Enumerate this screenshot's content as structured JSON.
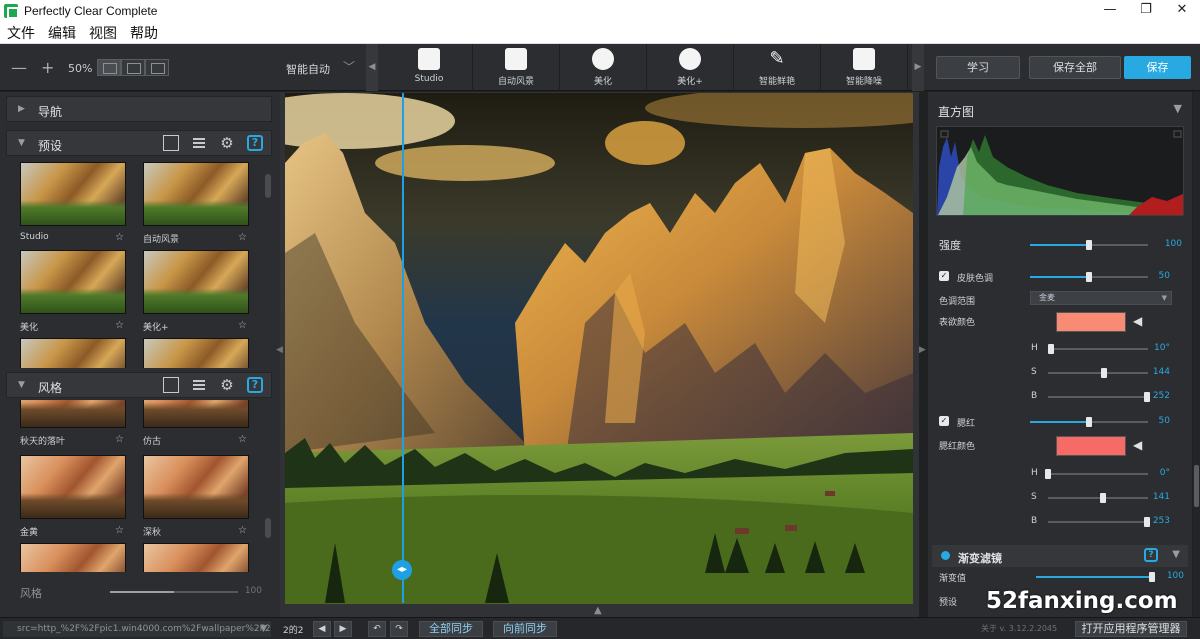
{
  "window": {
    "title": "Perfectly Clear Complete",
    "minimize": "—",
    "maximize": "❐",
    "close": "✕"
  },
  "menu": [
    "文件",
    "编辑",
    "视图",
    "帮助"
  ],
  "toolbar": {
    "zoom_out": "—",
    "zoom_in": "+",
    "zoom_value": "50%",
    "auto_preset": "智能自动",
    "presets": [
      "Studio",
      "自动风景",
      "美化",
      "美化+",
      "智能鲜艳",
      "智能降噪"
    ],
    "learn": "学习",
    "save_all": "保存全部",
    "save": "保存"
  },
  "left_panel": {
    "nav_title": "导航",
    "presets_title": "预设",
    "presets": [
      {
        "label": "Studio",
        "star": "☆"
      },
      {
        "label": "自动风景",
        "star": "☆"
      },
      {
        "label": "美化",
        "star": "☆"
      },
      {
        "label": "美化+",
        "star": "☆"
      }
    ],
    "styles_title": "风格",
    "styles": [
      {
        "label": "秋天的落叶",
        "star": "☆"
      },
      {
        "label": "仿古",
        "star": "☆"
      },
      {
        "label": "金黄",
        "star": "☆"
      },
      {
        "label": "深秋",
        "star": "☆"
      }
    ],
    "style_slider_label": "风格",
    "style_slider_value": "100",
    "style_slider_level": 0.5
  },
  "right_panel": {
    "histogram_title": "直方图",
    "strength_label": "强度",
    "strength_value": "100",
    "strength_level": 0.5,
    "skin_tone_label": "皮肤色调",
    "skin_tone_value": "50",
    "skin_tone_level": 0.5,
    "tone_range_label": "色调范围",
    "tone_range_value": "金麦",
    "target_color_label": "表欲颜色",
    "target_color": "#f98a74",
    "h1_label": "H",
    "h1_value": "10°",
    "h1_level": 0.03,
    "s1_label": "S",
    "s1_value": "144",
    "s1_level": 0.56,
    "b1_label": "B",
    "b1_value": "252",
    "b1_level": 0.99,
    "blush_label": "腮红",
    "blush_value": "50",
    "blush_level": 0.5,
    "blush_color_label": "腮红颜色",
    "blush_color": "#f66b66",
    "h2_label": "H",
    "h2_value": "0°",
    "h2_level": 0.0,
    "s2_label": "S",
    "s2_value": "141",
    "s2_level": 0.55,
    "b2_label": "B",
    "b2_value": "253",
    "b2_level": 0.99,
    "gradient_title": "渐变滤镜",
    "gradient_param_label": "渐变值",
    "gradient_param_value": "100",
    "gradient_param_level": 1.0,
    "preset_label": "预设"
  },
  "status": {
    "path": "src=http_%2F%2Fpic1.win4000.com%2Fwallpaper%2F20",
    "page": "2的2",
    "prev": "◀",
    "next": "▶",
    "sync_all": "全部同步",
    "sync_forward": "向前同步",
    "version": "关于 v. 3.12.2.2045",
    "open_app_manager": "打开应用程序管理器"
  },
  "watermark": "52fanxing.com",
  "colors": {
    "accent": "#29a9e1",
    "panel": "#2b2d30",
    "save_button": "#29a9e1"
  }
}
